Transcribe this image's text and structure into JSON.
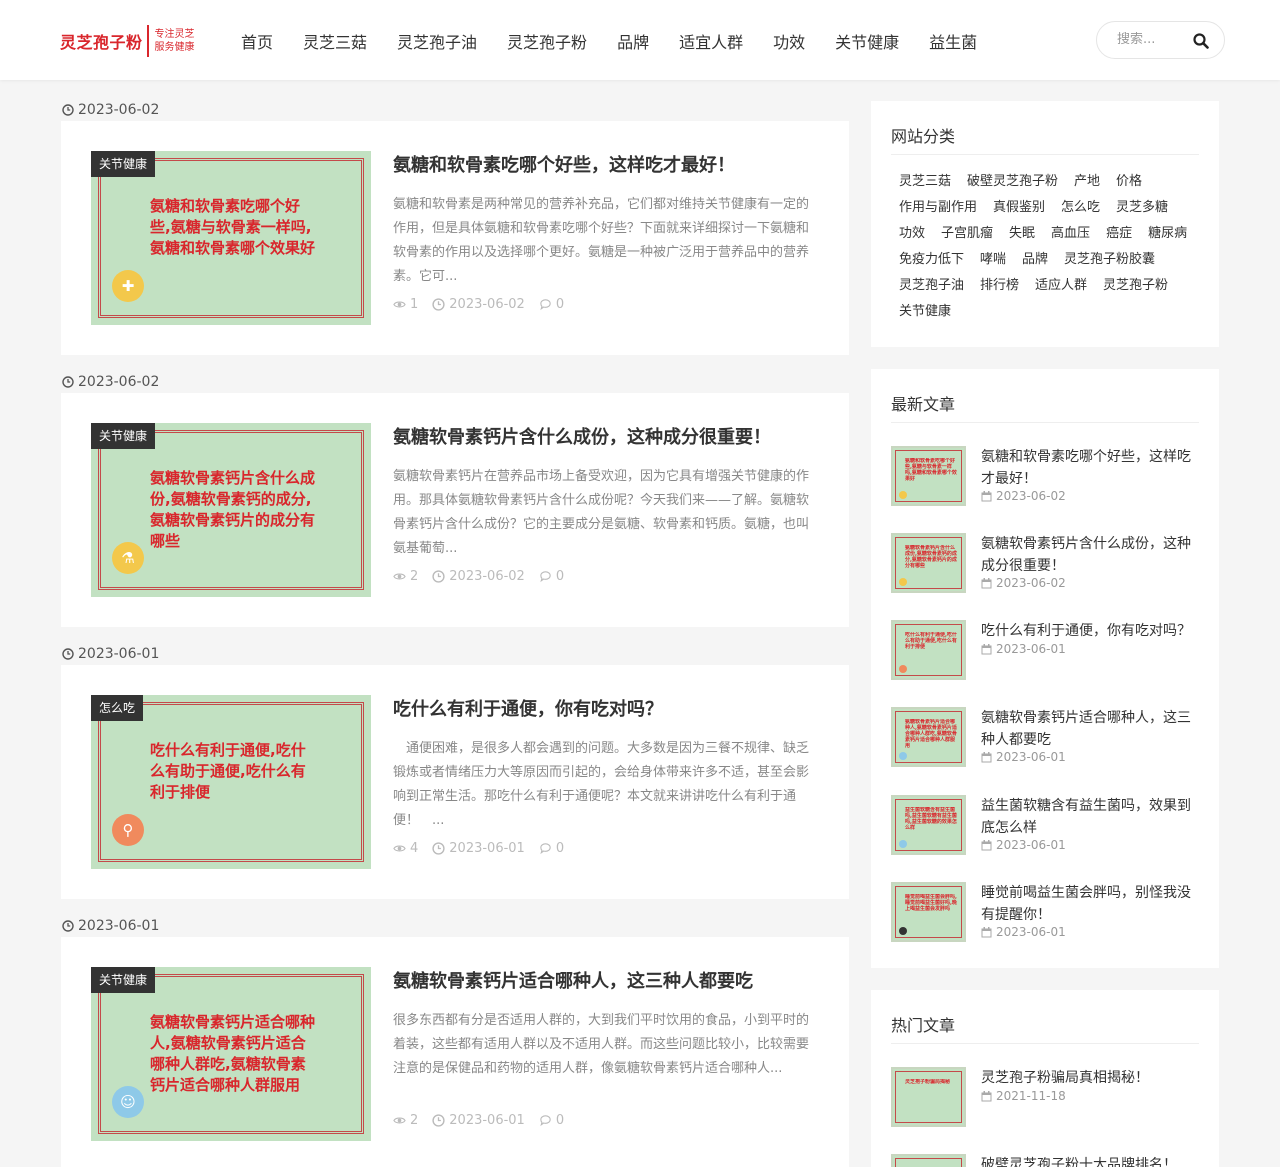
{
  "header": {
    "logo": {
      "main": "灵芝孢子粉",
      "sub1": "专注灵芝",
      "sub2": "服务健康"
    },
    "nav": [
      "首页",
      "灵芝三菇",
      "灵芝孢子油",
      "灵芝孢子粉",
      "品牌",
      "适宜人群",
      "功效",
      "关节健康",
      "益生菌"
    ],
    "search_placeholder": "搜索..."
  },
  "articles": [
    {
      "date": "2023-06-02",
      "category": "关节健康",
      "thumb_text": "氨糖和软骨素吃哪个好些,氨糖与软骨素一样吗,氨糖和软骨素哪个效果好",
      "thumb_icon": "bandage-icon",
      "thumb_color": "#f3c84b",
      "title": "氨糖和软骨素吃哪个好些，这样吃才最好！",
      "excerpt": "氨糖和软骨素是两种常见的营养补充品，它们都对维持关节健康有一定的作用，但是具体氨糖和软骨素吃哪个好些？下面就来详细探讨一下氨糖和软骨素的作用以及选择哪个更好。氨糖是一种被广泛用于营养品中的营养素。它可...",
      "views": "1",
      "meta_date": "2023-06-02",
      "comments": "0"
    },
    {
      "date": "2023-06-02",
      "category": "关节健康",
      "thumb_text": "氨糖软骨素钙片含什么成份,氨糖软骨素钙的成分,氨糖软骨素钙片的成分有哪些",
      "thumb_icon": "flask-icon",
      "thumb_color": "#f3c84b",
      "title": "氨糖软骨素钙片含什么成份，这种成分很重要！",
      "excerpt": "氨糖软骨素钙片在营养品市场上备受欢迎，因为它具有增强关节健康的作用。那具体氨糖软骨素钙片含什么成份呢？今天我们来——了解。氨糖软骨素钙片含什么成份？它的主要成分是氨糖、软骨素和钙质。氨糖，也叫氨基葡萄...",
      "views": "2",
      "meta_date": "2023-06-02",
      "comments": "0"
    },
    {
      "date": "2023-06-01",
      "category": "怎么吃",
      "thumb_text": "吃什么有利于通便,吃什么有助于通便,吃什么有利于排便",
      "thumb_icon": "magnifier-icon",
      "thumb_color": "#f08a5d",
      "title": "吃什么有利于通便，你有吃对吗？",
      "excerpt": "　通便困难，是很多人都会遇到的问题。大多数是因为三餐不规律、缺乏锻炼或者情绪压力大等原因而引起的，会给身体带来许多不适，甚至会影响到正常生活。那吃什么有利于通便呢？本文就来讲讲吃什么有利于通便！　...",
      "views": "4",
      "meta_date": "2023-06-01",
      "comments": "0"
    },
    {
      "date": "2023-06-01",
      "category": "关节健康",
      "thumb_text": "氨糖软骨素钙片适合哪种人,氨糖软骨素钙片适合哪种人群吃,氨糖软骨素钙片适合哪种人群服用",
      "thumb_icon": "doctor-icon",
      "thumb_color": "#8ec9e8",
      "title": "氨糖软骨素钙片适合哪种人，这三种人都要吃",
      "excerpt": "很多东西都有分是否适用人群的，大到我们平时饮用的食品，小到平时的着装，这些都有适用人群以及不适用人群。而这些问题比较小，比较需要注意的是保健品和药物的适用人群，像氨糖软骨素钙片适合哪种人...",
      "views": "2",
      "meta_date": "2023-06-01",
      "comments": "0"
    }
  ],
  "sidebar": {
    "categories": {
      "title": "网站分类",
      "tags": [
        "灵芝三菇",
        "破壁灵芝孢子粉",
        "产地",
        "价格",
        "作用与副作用",
        "真假鉴别",
        "怎么吃",
        "灵芝多糖",
        "功效",
        "子宫肌瘤",
        "失眠",
        "高血压",
        "癌症",
        "糖尿病",
        "免疫力低下",
        "哮喘",
        "品牌",
        "灵芝孢子粉胶囊",
        "灵芝孢子油",
        "排行榜",
        "适应人群",
        "灵芝孢子粉",
        "关节健康"
      ]
    },
    "latest": {
      "title": "最新文章",
      "posts": [
        {
          "title": "氨糖和软骨素吃哪个好些，这样吃才最好！",
          "date": "2023-06-02",
          "thumb_text": "氨糖和软骨素吃哪个好些,氨糖与软骨素一样吗,氨糖和软骨素哪个效果好",
          "dot": "#f3c84b"
        },
        {
          "title": "氨糖软骨素钙片含什么成份，这种成分很重要！",
          "date": "2023-06-02",
          "thumb_text": "氨糖软骨素钙片含什么成份,氨糖软骨素钙的成分,氨糖软骨素钙片的成分有哪些",
          "dot": "#f3c84b"
        },
        {
          "title": "吃什么有利于通便，你有吃对吗？",
          "date": "2023-06-01",
          "thumb_text": "吃什么有利于通便,吃什么有助于通便,吃什么有利于排便",
          "dot": "#f08a5d"
        },
        {
          "title": "氨糖软骨素钙片适合哪种人，这三种人都要吃",
          "date": "2023-06-01",
          "thumb_text": "氨糖软骨素钙片适合哪种人,氨糖软骨素钙片适合哪种人群吃,氨糖软骨素钙片适合哪种人群服用",
          "dot": "#8ec9e8"
        },
        {
          "title": "益生菌软糖含有益生菌吗，效果到底怎么样",
          "date": "2023-06-01",
          "thumb_text": "益生菌软糖含有益生菌吗,益生菌软糖有益生菌吗,益生菌软糖的效果怎么样",
          "dot": "#8ec9e8"
        },
        {
          "title": "睡觉前喝益生菌会胖吗，别怪我没有提醒你！",
          "date": "2023-06-01",
          "thumb_text": "睡觉前喝益生菌会胖吗,睡觉前喝益生菌好吗,晚上喝益生菌会发胖吗",
          "dot": "#333333"
        }
      ]
    },
    "hot": {
      "title": "热门文章",
      "posts": [
        {
          "title": "灵芝孢子粉骗局真相揭秘！",
          "date": "2021-11-18",
          "thumb_text": "灵芝孢子粉骗局揭秘",
          "dot": ""
        },
        {
          "title": "破壁灵芝孢子粉十大品牌排名！",
          "date": "",
          "thumb_text": "",
          "dot": ""
        }
      ]
    }
  }
}
